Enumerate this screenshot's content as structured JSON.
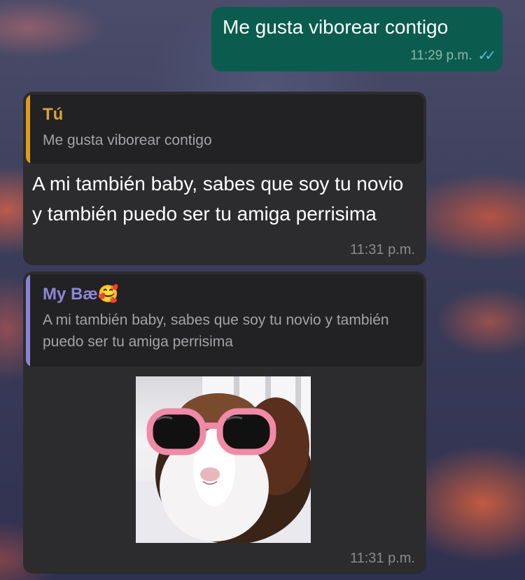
{
  "messages": {
    "outgoing": {
      "text": "Me gusta viborear contigo",
      "time": "11:29 p.m."
    },
    "incoming_1": {
      "reply_author": "Tú",
      "reply_quote": "Me gusta viborear contigo",
      "text": "A mi también baby, sabes que soy tu novio y también puedo ser tu amiga perrisima",
      "time": "11:31 p.m."
    },
    "incoming_2": {
      "reply_author": "My Bæ🥰",
      "reply_quote": "A mi también baby, sabes que soy tu novio y también puedo ser tu amiga perrisima",
      "sticker": "guinea-pig-with-pink-sunglasses",
      "time": "11:31 p.m."
    }
  },
  "colors": {
    "outgoing_bubble": "#0b5c4e",
    "incoming_bubble": "#2c2c2e",
    "reply_bar_you": "#e09c1c",
    "reply_bar_contact": "#8b82d8",
    "read_ticks": "#53bdeb"
  }
}
